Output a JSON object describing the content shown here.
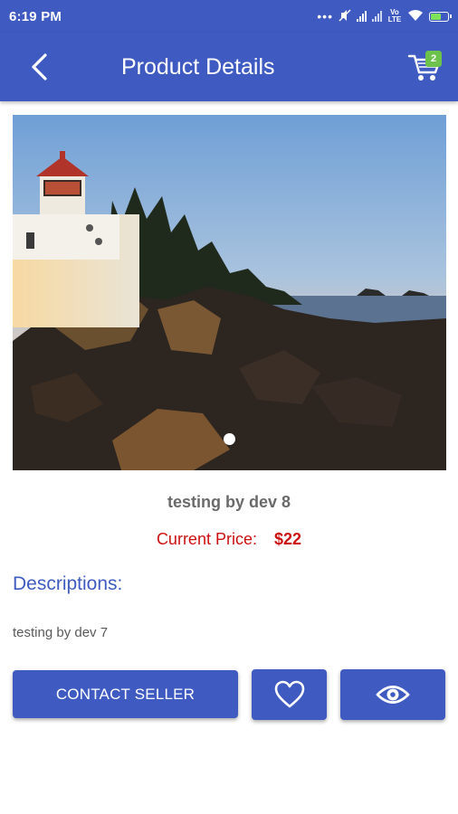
{
  "status_bar": {
    "time": "6:19 PM",
    "more": "•••",
    "network_label": "Vo LTE"
  },
  "app_bar": {
    "title": "Product Details",
    "back_icon": "chevron-left-icon",
    "cart_icon": "shopping-cart-icon",
    "cart_count": "2"
  },
  "product": {
    "image_description_icon": "lighthouse-photo",
    "name": "testing by dev 8",
    "price_label": "Current Price:",
    "price_value": "$22",
    "description_heading": "Descriptions:",
    "description_text": "testing by dev 7"
  },
  "actions": {
    "contact_label": "CONTACT SELLER",
    "favorite_icon": "heart-icon",
    "view_icon": "eye-icon"
  },
  "colors": {
    "primary": "#3f5bc1",
    "price": "#cc1111",
    "badge": "#6cc24a"
  }
}
